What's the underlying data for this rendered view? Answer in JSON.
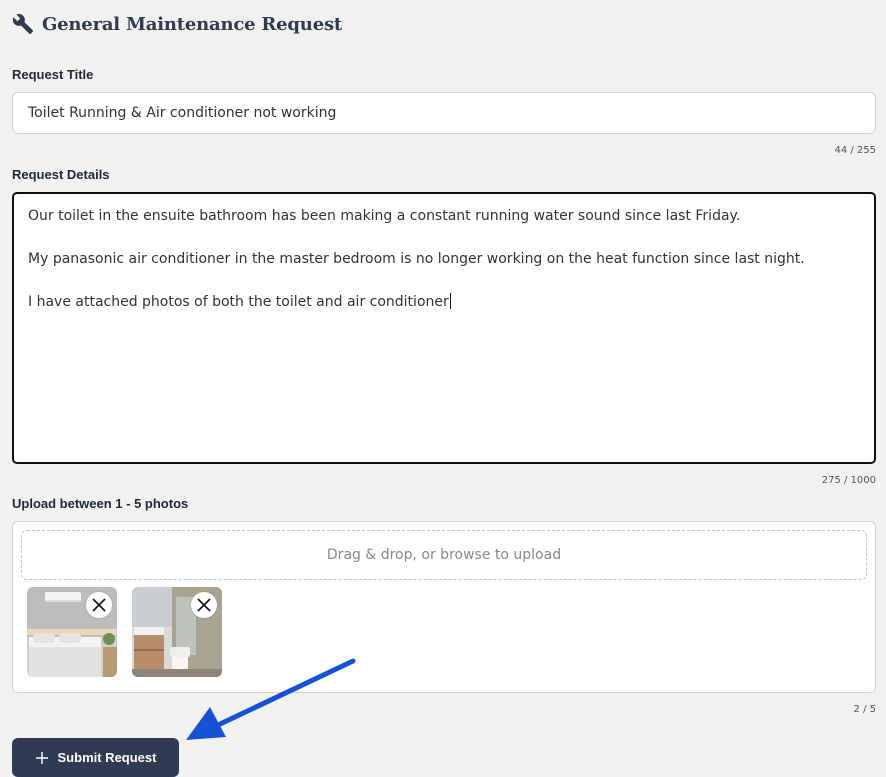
{
  "header": {
    "title": "General Maintenance Request",
    "icon": "wrench-icon"
  },
  "form": {
    "title_label": "Request Title",
    "title_value": "Toilet Running & Air conditioner not working",
    "title_counter": "44 / 255",
    "details_label": "Request Details",
    "details_paragraphs": [
      "Our toilet in the ensuite bathroom has been making a constant running water sound since last Friday.",
      "My panasonic air conditioner in the master bedroom is no longer working on the heat function since last night.",
      "I have attached photos of both the toilet and air conditioner"
    ],
    "details_counter": "275 / 1000",
    "upload_label": "Upload between 1 - 5 photos",
    "dropzone_text": "Drag & drop, or browse to upload",
    "photos": [
      {
        "subject": "bedroom with air conditioner",
        "remove_icon": "close-icon"
      },
      {
        "subject": "bathroom with toilet",
        "remove_icon": "close-icon"
      }
    ],
    "photo_counter": "2 / 5",
    "submit_label": "Submit Request",
    "submit_icon": "plus-icon"
  },
  "colors": {
    "page_bg": "#f1f1f2",
    "primary": "#2e3b52",
    "annotation_arrow": "#1553d6"
  }
}
